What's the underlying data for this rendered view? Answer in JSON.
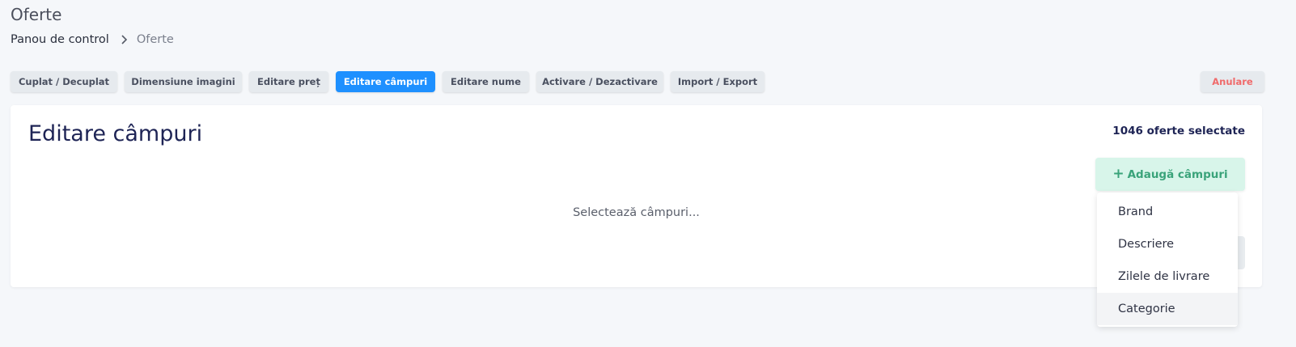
{
  "page": {
    "title": "Oferte"
  },
  "breadcrumb": {
    "home": "Panou de control",
    "current": "Oferte"
  },
  "tabs": [
    {
      "label": "Cuplat / Decuplat",
      "active": false
    },
    {
      "label": "Dimensiune imagini",
      "active": false
    },
    {
      "label": "Editare preț",
      "active": false
    },
    {
      "label": "Editare câmpuri",
      "active": true
    },
    {
      "label": "Editare nume",
      "active": false
    },
    {
      "label": "Activare / Dezactivare",
      "active": false
    },
    {
      "label": "Import / Export",
      "active": false
    }
  ],
  "cancel_label": "Anulare",
  "card": {
    "title": "Editare câmpuri",
    "selected_count": "1046 oferte selectate",
    "add_fields_label": "Adaugă câmpuri",
    "placeholder": "Selectează câmpuri..."
  },
  "dropdown": {
    "items": [
      "Brand",
      "Descriere",
      "Zilele de livrare",
      "Categorie"
    ]
  },
  "colors": {
    "accent": "#1e90ff",
    "tab_bg": "#e6eaee",
    "cancel_text": "#f06a6a",
    "add_btn_bg": "#d8f5ea",
    "add_btn_text": "#3aa37a",
    "title_color": "#1e2455"
  }
}
